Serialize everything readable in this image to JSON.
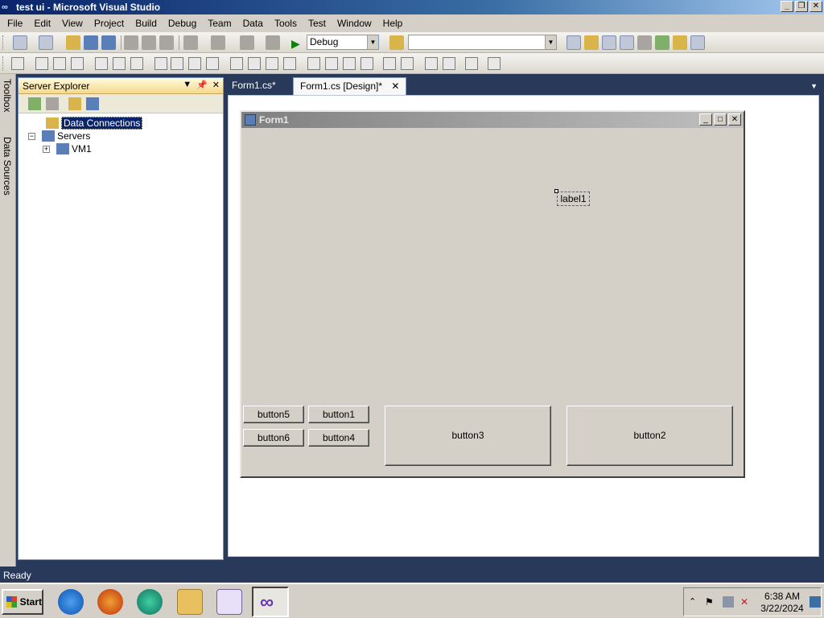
{
  "window": {
    "title": "test ui - Microsoft Visual Studio",
    "icon": "infinity-icon"
  },
  "menu": [
    "File",
    "Edit",
    "View",
    "Project",
    "Build",
    "Debug",
    "Team",
    "Data",
    "Tools",
    "Test",
    "Window",
    "Help"
  ],
  "toolbar": {
    "configuration": "Debug",
    "platform": ""
  },
  "left_tabs": {
    "toolbox": "Toolbox",
    "data_sources": "Data Sources"
  },
  "server_explorer": {
    "title": "Server Explorer",
    "tree": {
      "data_connections": "Data Connections",
      "servers": "Servers",
      "vm1": "VM1"
    }
  },
  "tabs": {
    "code": "Form1.cs*",
    "design": "Form1.cs [Design]*"
  },
  "form": {
    "title": "Form1",
    "label1": "label1",
    "buttons": {
      "b5": "button5",
      "b1": "button1",
      "b6": "button6",
      "b4": "button4",
      "b3": "button3",
      "b2": "button2"
    }
  },
  "status": "Ready",
  "taskbar": {
    "start": "Start",
    "time": "6:38 AM",
    "date": "3/22/2024"
  }
}
